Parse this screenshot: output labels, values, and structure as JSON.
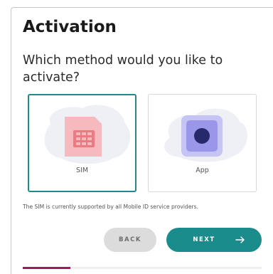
{
  "header": {
    "title": "Activation"
  },
  "prompt": {
    "question": "Which method would you like to activate?"
  },
  "options": [
    {
      "label": "SIM",
      "icon": "sim-card-icon",
      "selected": true
    },
    {
      "label": "App",
      "icon": "app-icon",
      "selected": false
    }
  ],
  "info_text": "The SIM is currently supported by all Mobile ID service providers.",
  "buttons": {
    "back_label": "BACK",
    "next_label": "NEXT"
  },
  "progress": {
    "fraction": 0.2
  },
  "colors": {
    "accent": "#1a8c8c",
    "progress": "#a3175d",
    "sim_icon": "#f08a8f",
    "app_icon": "#8f8ce6"
  }
}
